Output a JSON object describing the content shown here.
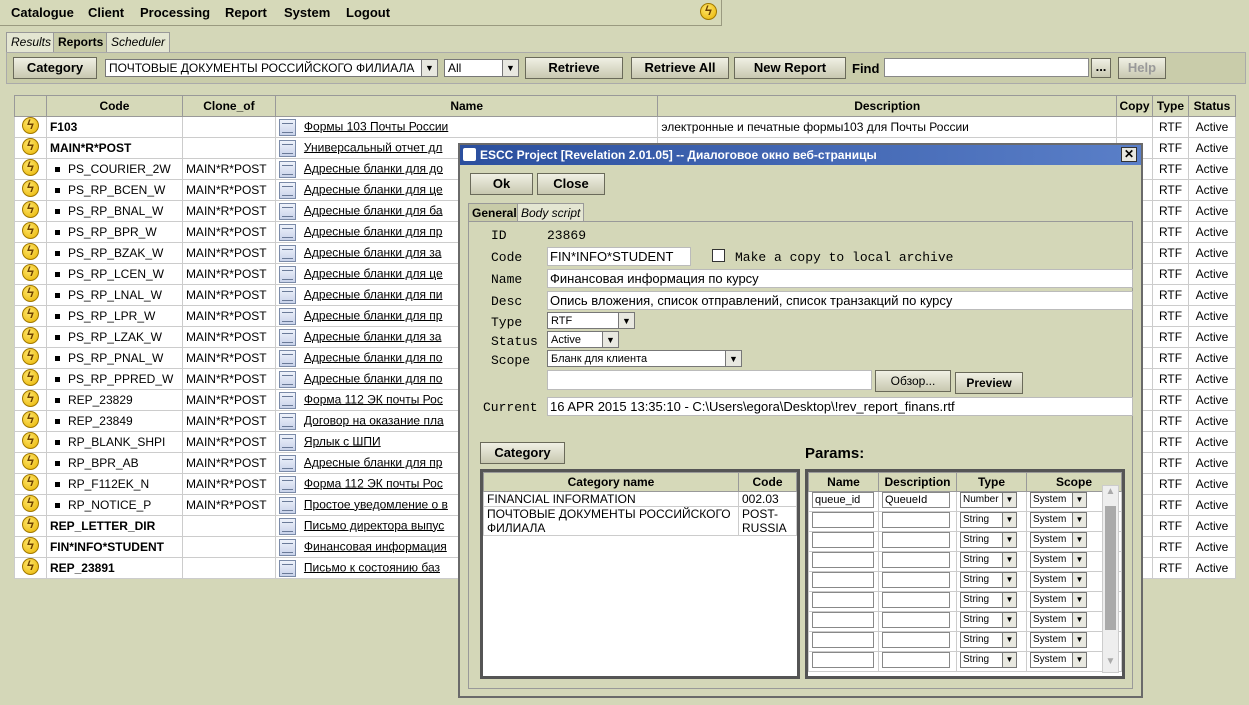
{
  "menu": [
    "Catalogue",
    "Client",
    "Processing",
    "Report",
    "System",
    "Logout"
  ],
  "tabs": [
    "Results",
    "Reports",
    "Scheduler"
  ],
  "toolbar": {
    "category_button": "Category",
    "category_value": "ПОЧТОВЫЕ ДОКУМЕНТЫ РОССИЙСКОГО ФИЛИАЛА",
    "filter_value": "All",
    "retrieve": "Retrieve",
    "retrieve_all": "Retrieve All",
    "new_report": "New Report",
    "find_label": "Find",
    "find_value": "",
    "browse": "...",
    "help": "Help"
  },
  "grid": {
    "headers": [
      "Code",
      "Clone_of",
      "Name",
      "Description",
      "Copy",
      "Type",
      "Status"
    ],
    "rows": [
      {
        "code": "F103",
        "clone": "",
        "name": "Формы 103 Почты России",
        "desc": "электронные и печатные формы103 для Почты России",
        "type": "RTF",
        "status": "Active",
        "bold": true,
        "child": false
      },
      {
        "code": "MAIN*R*POST",
        "clone": "",
        "name": "Универсальный отчет дл",
        "desc": "",
        "type": "RTF",
        "status": "Active",
        "bold": true,
        "child": false
      },
      {
        "code": "PS_COURIER_2W",
        "clone": "MAIN*R*POST",
        "name": "Адресные бланки для до",
        "desc": "",
        "type": "RTF",
        "status": "Active",
        "bold": false,
        "child": true
      },
      {
        "code": "PS_RP_BCEN_W",
        "clone": "MAIN*R*POST",
        "name": "Адресные бланки для це",
        "desc": "",
        "type": "RTF",
        "status": "Active",
        "bold": false,
        "child": true
      },
      {
        "code": "PS_RP_BNAL_W",
        "clone": "MAIN*R*POST",
        "name": "Адресные бланки для ба",
        "desc": "",
        "type": "RTF",
        "status": "Active",
        "bold": false,
        "child": true
      },
      {
        "code": "PS_RP_BPR_W",
        "clone": "MAIN*R*POST",
        "name": "Адресные бланки для пр",
        "desc": "",
        "type": "RTF",
        "status": "Active",
        "bold": false,
        "child": true
      },
      {
        "code": "PS_RP_BZAK_W",
        "clone": "MAIN*R*POST",
        "name": "Адресные бланки для за",
        "desc": "",
        "type": "RTF",
        "status": "Active",
        "bold": false,
        "child": true
      },
      {
        "code": "PS_RP_LCEN_W",
        "clone": "MAIN*R*POST",
        "name": "Адресные бланки для це",
        "desc": "",
        "type": "RTF",
        "status": "Active",
        "bold": false,
        "child": true
      },
      {
        "code": "PS_RP_LNAL_W",
        "clone": "MAIN*R*POST",
        "name": "Адресные бланки для пи",
        "desc": "",
        "type": "RTF",
        "status": "Active",
        "bold": false,
        "child": true
      },
      {
        "code": "PS_RP_LPR_W",
        "clone": "MAIN*R*POST",
        "name": "Адресные бланки для пр",
        "desc": "",
        "type": "RTF",
        "status": "Active",
        "bold": false,
        "child": true
      },
      {
        "code": "PS_RP_LZAK_W",
        "clone": "MAIN*R*POST",
        "name": "Адресные бланки для за",
        "desc": "",
        "type": "RTF",
        "status": "Active",
        "bold": false,
        "child": true
      },
      {
        "code": "PS_RP_PNAL_W",
        "clone": "MAIN*R*POST",
        "name": "Адресные бланки для по",
        "desc": "",
        "type": "RTF",
        "status": "Active",
        "bold": false,
        "child": true
      },
      {
        "code": "PS_RP_PPRED_W",
        "clone": "MAIN*R*POST",
        "name": "Адресные бланки для по",
        "desc": "",
        "type": "RTF",
        "status": "Active",
        "bold": false,
        "child": true
      },
      {
        "code": "REP_23829",
        "clone": "MAIN*R*POST",
        "name": "Форма 112 ЭК почты Рос",
        "desc": "",
        "type": "RTF",
        "status": "Active",
        "bold": false,
        "child": true
      },
      {
        "code": "REP_23849",
        "clone": "MAIN*R*POST",
        "name": "Договор на оказание пла",
        "desc": "",
        "type": "RTF",
        "status": "Active",
        "bold": false,
        "child": true
      },
      {
        "code": "RP_BLANK_SHPI",
        "clone": "MAIN*R*POST",
        "name": "Ярлык с ШПИ",
        "desc": "",
        "type": "RTF",
        "status": "Active",
        "bold": false,
        "child": true
      },
      {
        "code": "RP_BPR_AB",
        "clone": "MAIN*R*POST",
        "name": "Адресные бланки для пр",
        "desc": "",
        "type": "RTF",
        "status": "Active",
        "bold": false,
        "child": true
      },
      {
        "code": "RP_F112EK_N",
        "clone": "MAIN*R*POST",
        "name": "Форма 112 ЭК почты Рос",
        "desc": "",
        "type": "RTF",
        "status": "Active",
        "bold": false,
        "child": true
      },
      {
        "code": "RP_NOTICE_P",
        "clone": "MAIN*R*POST",
        "name": "Простое уведомление о в",
        "desc": "",
        "type": "RTF",
        "status": "Active",
        "bold": false,
        "child": true
      },
      {
        "code": "REP_LETTER_DIR",
        "clone": "",
        "name": "Письмо директора выпус",
        "desc": "",
        "type": "RTF",
        "status": "Active",
        "bold": true,
        "child": false
      },
      {
        "code": "FIN*INFO*STUDENT",
        "clone": "",
        "name": "Финансовая информация",
        "desc": "",
        "type": "RTF",
        "status": "Active",
        "bold": true,
        "child": false
      },
      {
        "code": "REP_23891",
        "clone": "",
        "name": "Письмо к состоянию баз",
        "desc": "",
        "type": "RTF",
        "status": "Active",
        "bold": true,
        "child": false
      }
    ]
  },
  "dialog": {
    "title": "ESCC Project [Revelation 2.01.05] -- Диалоговое окно веб-страницы",
    "ok": "Ok",
    "close": "Close",
    "tabs": [
      "General",
      "Body script"
    ],
    "id_label": "ID",
    "id_value": "23869",
    "code_label": "Code",
    "code_value": "FIN*INFO*STUDENT",
    "copy_label": "Make a copy to local archive",
    "name_label": "Name",
    "name_value": "Финансовая информация по курсу",
    "desc_label": "Desc",
    "desc_value": "Опись вложения, список отправлений, список транзакций по курсу",
    "type_label": "Type",
    "type_value": "RTF",
    "status_label": "Status",
    "status_value": "Active",
    "scope_label": "Scope",
    "scope_value": "Бланк для клиента",
    "browse": "Обзор...",
    "preview": "Preview",
    "current_label": "Current",
    "current_value": "16 APR 2015 13:35:10 - C:\\Users\\egora\\Desktop\\!rev_report_finans.rtf",
    "category_button": "Category",
    "params_label": "Params:",
    "cat_headers": [
      "Category name",
      "Code"
    ],
    "cat_rows": [
      {
        "name": "FINANCIAL INFORMATION",
        "code": "002.03"
      },
      {
        "name": "ПОЧТОВЫЕ ДОКУМЕНТЫ РОССИЙСКОГО ФИЛИАЛА",
        "code": "POST-RUSSIA"
      }
    ],
    "param_headers": [
      "Name",
      "Description",
      "Type",
      "Scope"
    ],
    "param_rows": [
      {
        "name": "queue_id",
        "desc": "QueueId",
        "type": "Number",
        "scope": "System"
      },
      {
        "name": "",
        "desc": "",
        "type": "String",
        "scope": "System"
      },
      {
        "name": "",
        "desc": "",
        "type": "String",
        "scope": "System"
      },
      {
        "name": "",
        "desc": "",
        "type": "String",
        "scope": "System"
      },
      {
        "name": "",
        "desc": "",
        "type": "String",
        "scope": "System"
      },
      {
        "name": "",
        "desc": "",
        "type": "String",
        "scope": "System"
      },
      {
        "name": "",
        "desc": "",
        "type": "String",
        "scope": "System"
      },
      {
        "name": "",
        "desc": "",
        "type": "String",
        "scope": "System"
      },
      {
        "name": "",
        "desc": "",
        "type": "String",
        "scope": "System"
      }
    ]
  }
}
